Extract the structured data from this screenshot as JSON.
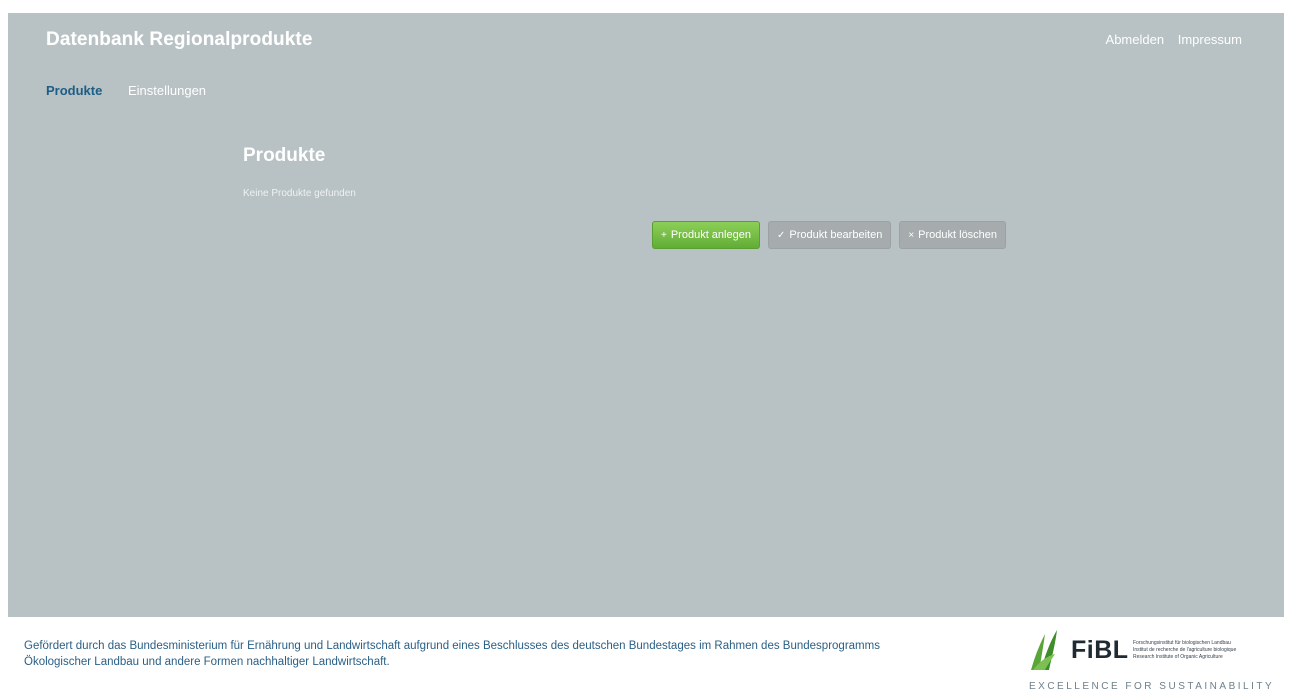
{
  "header": {
    "title": "Datenbank Regionalprodukte",
    "links": {
      "logout": "Abmelden",
      "imprint": "Impressum"
    }
  },
  "nav": {
    "items": [
      {
        "label": "Produkte",
        "active": true
      },
      {
        "label": "Einstellungen",
        "active": false
      }
    ]
  },
  "content": {
    "title": "Produkte",
    "empty_message": "Keine Produkte gefunden"
  },
  "actions": {
    "create": {
      "icon": "+",
      "label": "Produkt anlegen"
    },
    "edit": {
      "icon": "✓",
      "label": "Produkt bearbeiten"
    },
    "delete": {
      "icon": "×",
      "label": "Produkt löschen"
    }
  },
  "footer": {
    "text": "Gefördert durch das Bundesministerium für Ernährung und Landwirtschaft aufgrund eines Beschlusses des deutschen Bundestages im Rahmen des Bundesprogramms Ökologischer Landbau und andere Formen nachhaltiger Landwirtschaft.",
    "logo": {
      "name": "FiBL",
      "lines": [
        "Forschungsinstitut für biologischen Landbau",
        "Institut de recherche de l'agriculture biologique",
        "Research Institute of Organic Agriculture"
      ],
      "tagline": "EXCELLENCE FOR SUSTAINABILITY"
    }
  },
  "colors": {
    "panel": "#b8c1c3",
    "accent_nav": "#1b5e86",
    "button_green": "#6fba42",
    "button_gray": "#a6abad",
    "footer_text": "#2a5f86"
  }
}
